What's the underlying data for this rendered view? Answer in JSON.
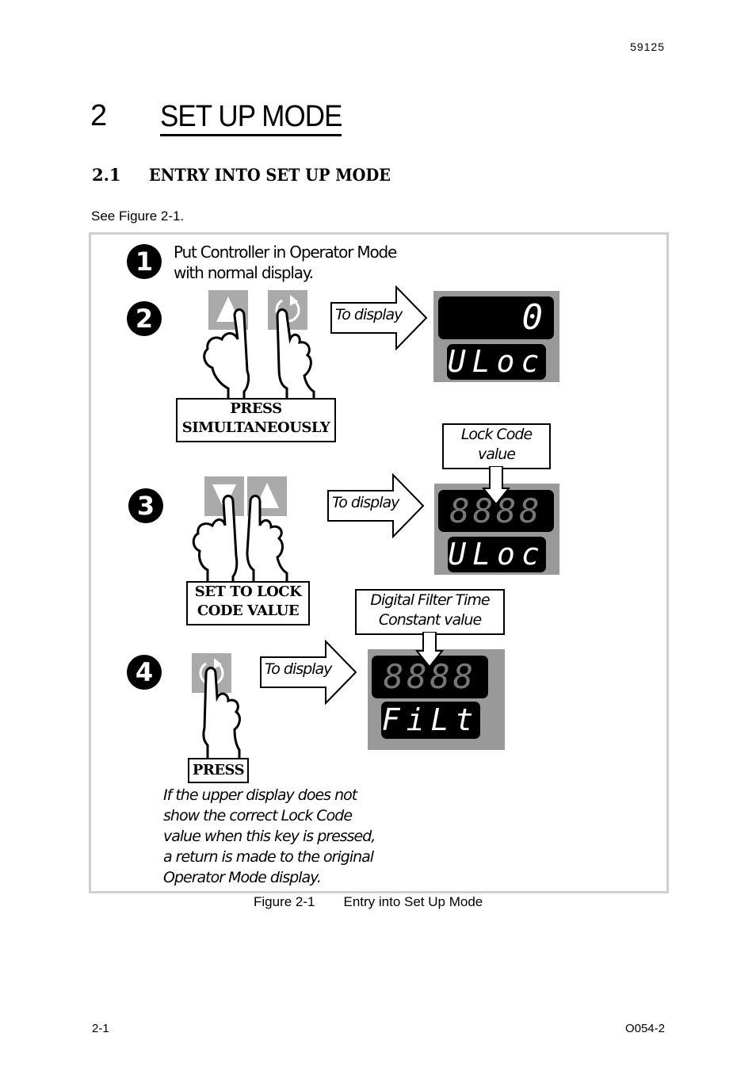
{
  "header": {
    "doc_number": "59125"
  },
  "chapter": {
    "number": "2",
    "title": "SET UP MODE"
  },
  "section": {
    "number": "2.1",
    "title": "ENTRY INTO SET UP MODE"
  },
  "intro": "See Figure 2-1.",
  "figure": {
    "steps": [
      {
        "number": "1",
        "text_lines": [
          "Put Controller in Operator Mode",
          "with normal display."
        ]
      },
      {
        "number": "2",
        "keys": [
          "up-arrow",
          "cycle"
        ],
        "action_label_lines": [
          "PRESS",
          "SIMULTANEOUSLY"
        ],
        "arrow_label": "To display",
        "display": {
          "upper": "0",
          "lower": "ULoc"
        }
      },
      {
        "number": "3",
        "keys": [
          "down-arrow",
          "up-arrow"
        ],
        "action_label_lines": [
          "SET TO LOCK",
          "CODE VALUE"
        ],
        "arrow_label": "To display",
        "callout_lines": [
          "Lock Code",
          "value"
        ],
        "display": {
          "upper": "8888",
          "lower": "ULoc"
        }
      },
      {
        "number": "4",
        "keys": [
          "cycle"
        ],
        "action_label_lines": [
          "PRESS"
        ],
        "arrow_label": "To display",
        "callout_lines": [
          "Digital Filter Time",
          "Constant value"
        ],
        "display": {
          "upper": "8888",
          "lower": "FiLt"
        }
      }
    ],
    "note_lines": [
      "If the upper display does not",
      "show the correct Lock Code",
      "value when this key is pressed,",
      "a return is made to the original",
      "Operator Mode display."
    ],
    "caption": {
      "label": "Figure 2-1",
      "title": "Entry into Set Up Mode"
    }
  },
  "footer": {
    "page": "2-1",
    "code": "O054-2"
  }
}
